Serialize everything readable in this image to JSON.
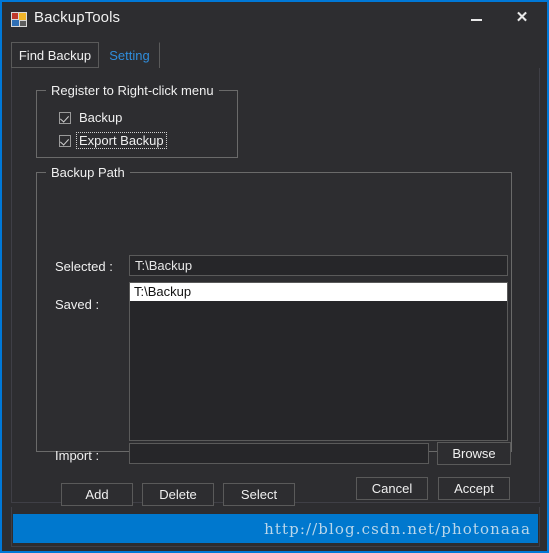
{
  "window": {
    "title": "BackupTools",
    "icon": "app-window-icon",
    "accent_color": "#0078d7",
    "background_color": "#2d2d30",
    "controls": {
      "minimize_label": "–",
      "close_label": "✕"
    }
  },
  "tabs": [
    {
      "label": "Find Backup",
      "active": false
    },
    {
      "label": "Setting",
      "active": true
    }
  ],
  "setting_tab": {
    "register_group": {
      "title": "Register to Right-click menu",
      "checkboxes": [
        {
          "label": "Backup",
          "checked": true,
          "focused": false
        },
        {
          "label": "Export Backup",
          "checked": true,
          "focused": true
        }
      ]
    },
    "backup_path_group": {
      "title": "Backup Path",
      "selected_label": "Selected :",
      "selected_value": "T:\\Backup",
      "selected_placeholder": "",
      "saved_label": "Saved :",
      "saved_items": [
        {
          "value": "T:\\Backup",
          "selected": true
        }
      ],
      "import_label": "Import :",
      "import_value": "",
      "import_placeholder": "",
      "browse_label": "Browse",
      "add_label": "Add",
      "delete_label": "Delete",
      "select_label": "Select"
    }
  },
  "dialog_buttons": {
    "cancel_label": "Cancel",
    "accept_label": "Accept"
  },
  "statusbar": {
    "watermark_text": "http://blog.csdn.net/photonaaa",
    "background_color": "#0078ce",
    "text_color": "#b9d6ea"
  }
}
